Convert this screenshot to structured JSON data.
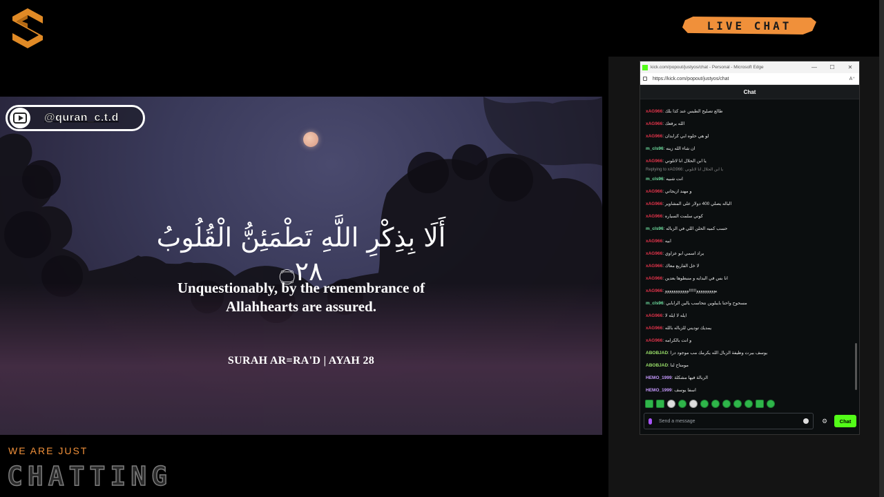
{
  "overlay": {
    "live_chat_label": "LIVE CHAT",
    "tagline": "WE ARE JUST",
    "chatting": "CHATTING"
  },
  "video": {
    "channel_handle": "@quran_c.t.d",
    "arabic_verse": "أَلَا بِذِكْرِ اللَّهِ تَطْمَئِنُّ الْقُلُوبُ ۝٢٨",
    "translation_line1": "Unquestionably, by the remembrance of",
    "translation_line2": "Allahhearts are assured.",
    "surah_ref": "SURAH AR=RA'D | AYAH 28"
  },
  "browser": {
    "window_title": "kick.com/popout/justyos/chat - Personal - Microsoft Edge",
    "url": "https://kick.com/popout/justyos/chat",
    "minimize": "—",
    "maximize": "☐",
    "close": "✕",
    "read_aloud": "A⁺"
  },
  "chat": {
    "header": "Chat",
    "placeholder": "Send a message",
    "send_label": "Chat",
    "gear_icon": "⚙",
    "colors": {
      "xAG966": "#e5344b",
      "m_cls96": "#6fe0a0",
      "ABOBJAD": "#9be26a",
      "HEMO_1999": "#c79bff",
      "accent": "#53fc18"
    },
    "messages": [
      {
        "user": "xAG966",
        "text": "طالع تصليح الطبس عند كذا بلك",
        "color": "#e5344b"
      },
      {
        "user": "xAG966",
        "text": "الله يرفعك",
        "color": "#e5344b"
      },
      {
        "user": "xAG966",
        "text": "لو هي حلوه ابي كرابدان",
        "color": "#e5344b"
      },
      {
        "user": "m_cls96",
        "text": "ان شاء الله زينه",
        "color": "#6fe0a0"
      },
      {
        "user": "xAG966",
        "text": "يا ابن الحلال انا لاتلوني",
        "color": "#e5344b"
      },
      {
        "user": "m_cls96",
        "text": "انت شبيه",
        "color": "#6fe0a0",
        "reply": "Replying to xAG966: يا ابن الحلال انا لاتلوني"
      },
      {
        "user": "xAG966",
        "text": "و مهند ازيجاني",
        "color": "#e5344b"
      },
      {
        "user": "xAG966",
        "text": "الباله يصلي 400 دولار على المشاوير",
        "color": "#e5344b"
      },
      {
        "user": "xAG966",
        "text": "كوني سلمت السياره",
        "color": "#e5344b"
      },
      {
        "user": "m_cls96",
        "text": "حسب كميه الحلن اللي في الزباله",
        "color": "#6fe0a0"
      },
      {
        "user": "xAG966",
        "text": "ابيه",
        "color": "#e5344b"
      },
      {
        "user": "xAG966",
        "text": "يراد اسمي ابو عزاوي",
        "color": "#e5344b"
      },
      {
        "user": "xAG966",
        "text": "لا خل الفاريع معاك",
        "color": "#e5344b"
      },
      {
        "user": "xAG966",
        "text": "انا بس في البدايه و منبطوها بعدين",
        "color": "#e5344b"
      },
      {
        "user": "xAG966",
        "text": "يووووووووو!!!!!!ووووووووووو",
        "color": "#e5344b"
      },
      {
        "user": "m_cls96",
        "text": "مسحوح واحنا بايبلوين نتحاسب يالين الرابابي",
        "color": "#6fe0a0"
      },
      {
        "user": "xAG966",
        "text": "ايله لا ايله لا",
        "color": "#e5344b"
      },
      {
        "user": "xAG966",
        "text": "يمديك توديني للزباله بالله",
        "color": "#e5344b"
      },
      {
        "user": "xAG966",
        "text": "و انت بالكرامه",
        "color": "#e5344b"
      },
      {
        "user": "ABOBJAD",
        "text": "يوسف بيرت وظيفة الزبال الله يكرمك مب موجود درا",
        "color": "#9be26a"
      },
      {
        "user": "ABOBJAD",
        "text": "مومتاح لنا",
        "color": "#9be26a"
      },
      {
        "user": "HEMO_1999",
        "text": "الزبالة فيها مشكلة",
        "color": "#c79bff"
      },
      {
        "user": "HEMO_1999",
        "text": "اسفا يوسف",
        "color": "#c79bff"
      }
    ]
  }
}
